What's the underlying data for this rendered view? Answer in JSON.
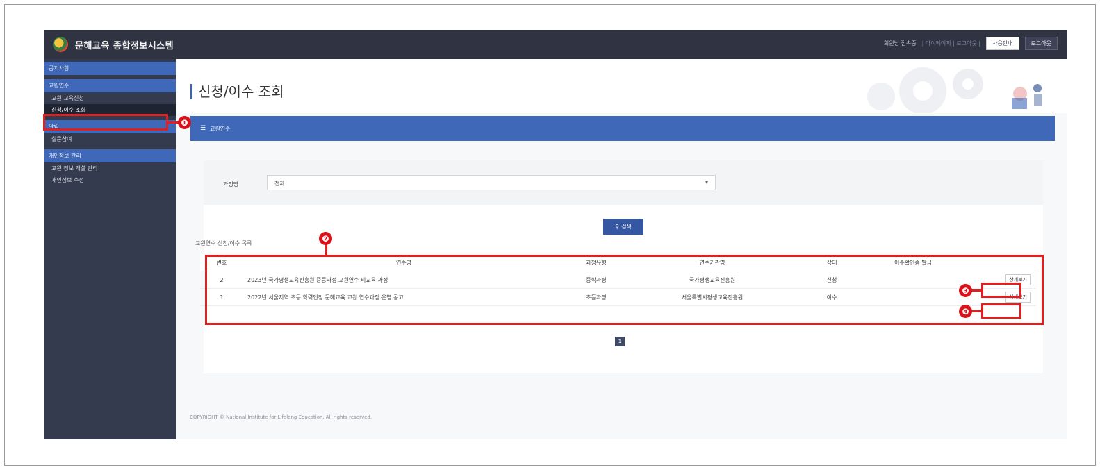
{
  "app": {
    "logo_text": "문해교육 종합정보시스템",
    "user_info": "회원님 접속중",
    "top_links": "| 마이페이지 | 로그아웃 |",
    "btn_site": "사용안내",
    "btn_logout": "로그아웃"
  },
  "sidebar": {
    "categories": [
      {
        "label": "공지사항"
      },
      {
        "label": "교원연수"
      },
      {
        "label": "알림"
      },
      {
        "label": "개인정보 관리"
      }
    ],
    "items": [
      {
        "label": "교원 교육신청"
      },
      {
        "label": "신청/이수 조회"
      },
      {
        "label": "설문참여"
      },
      {
        "label": "교원 정보 개설 관리"
      },
      {
        "label": "개인정보 수정"
      }
    ]
  },
  "main": {
    "page_title": "신청/이수 조회",
    "section_label": "교원연수",
    "filter_label": "과정명",
    "filter_value": "전체",
    "search_button": "검색",
    "list_title": "교원연수 신청/이수 목록",
    "table": {
      "headers": [
        "번호",
        "연수명",
        "과정유형",
        "연수기관명",
        "상태",
        "이수확인증 발급",
        ""
      ],
      "rows": [
        {
          "no": "2",
          "title": "2023년 국가평생교육진흥원 중등과정 교원연수 비교육 과정",
          "type": "중학과정",
          "org": "국가평생교육진흥원",
          "status": "신청",
          "cert": "",
          "action": "상세보기"
        },
        {
          "no": "1",
          "title": "2022년 서울지역 초등 학력인정 문해교육 교원 연수과정 운영 공고",
          "type": "초등과정",
          "org": "서울특별시평생교육진흥원",
          "status": "이수",
          "cert": "",
          "action": "상세보기"
        }
      ]
    },
    "page_number": "1",
    "copyright": "COPYRIGHT © National Institute for Lifelong Education. All rights reserved."
  },
  "annotations": {
    "markers": [
      "❶",
      "❷",
      "❸",
      "❹"
    ],
    "accent_color": "#e01f1f"
  }
}
